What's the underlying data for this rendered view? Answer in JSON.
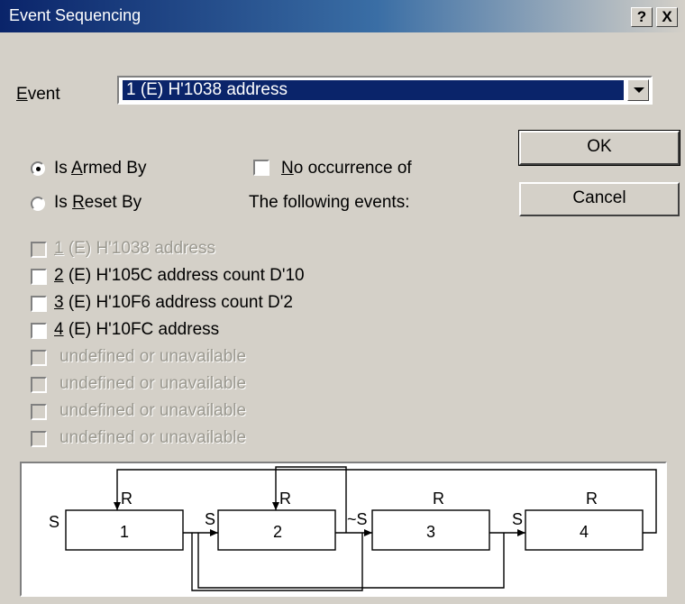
{
  "window": {
    "title": "Event Sequencing",
    "help_label": "?",
    "close_label": "X"
  },
  "event": {
    "label": "Event",
    "selected_value": "1 (E) H'1038 address"
  },
  "buttons": {
    "ok": "OK",
    "cancel": "Cancel"
  },
  "mode": {
    "armed_by": "Is Armed By",
    "reset_by": "Is Reset By",
    "selected": "armed_by"
  },
  "no_occurrence": {
    "label": "No occurrence of",
    "checked": false
  },
  "following_label": "The following events:",
  "events": [
    {
      "num": "1",
      "text": " (E) H'1038 address",
      "enabled": false,
      "checked": false
    },
    {
      "num": "2",
      "text": " (E) H'105C address count D'10",
      "enabled": true,
      "checked": false
    },
    {
      "num": "3",
      "text": " (E) H'10F6 address count D'2",
      "enabled": true,
      "checked": false
    },
    {
      "num": "4",
      "text": " (E) H'10FC address",
      "enabled": true,
      "checked": false
    },
    {
      "num": "",
      "text": "undefined or unavailable",
      "enabled": false,
      "checked": false
    },
    {
      "num": "",
      "text": "undefined or unavailable",
      "enabled": false,
      "checked": false
    },
    {
      "num": "",
      "text": "undefined or unavailable",
      "enabled": false,
      "checked": false
    },
    {
      "num": "",
      "text": "undefined or unavailable",
      "enabled": false,
      "checked": false
    }
  ],
  "diagram": {
    "start_label": "S",
    "reset_label": "R",
    "set_label": "S",
    "negate_label": "~S",
    "nodes": [
      "1",
      "2",
      "3",
      "4"
    ]
  }
}
